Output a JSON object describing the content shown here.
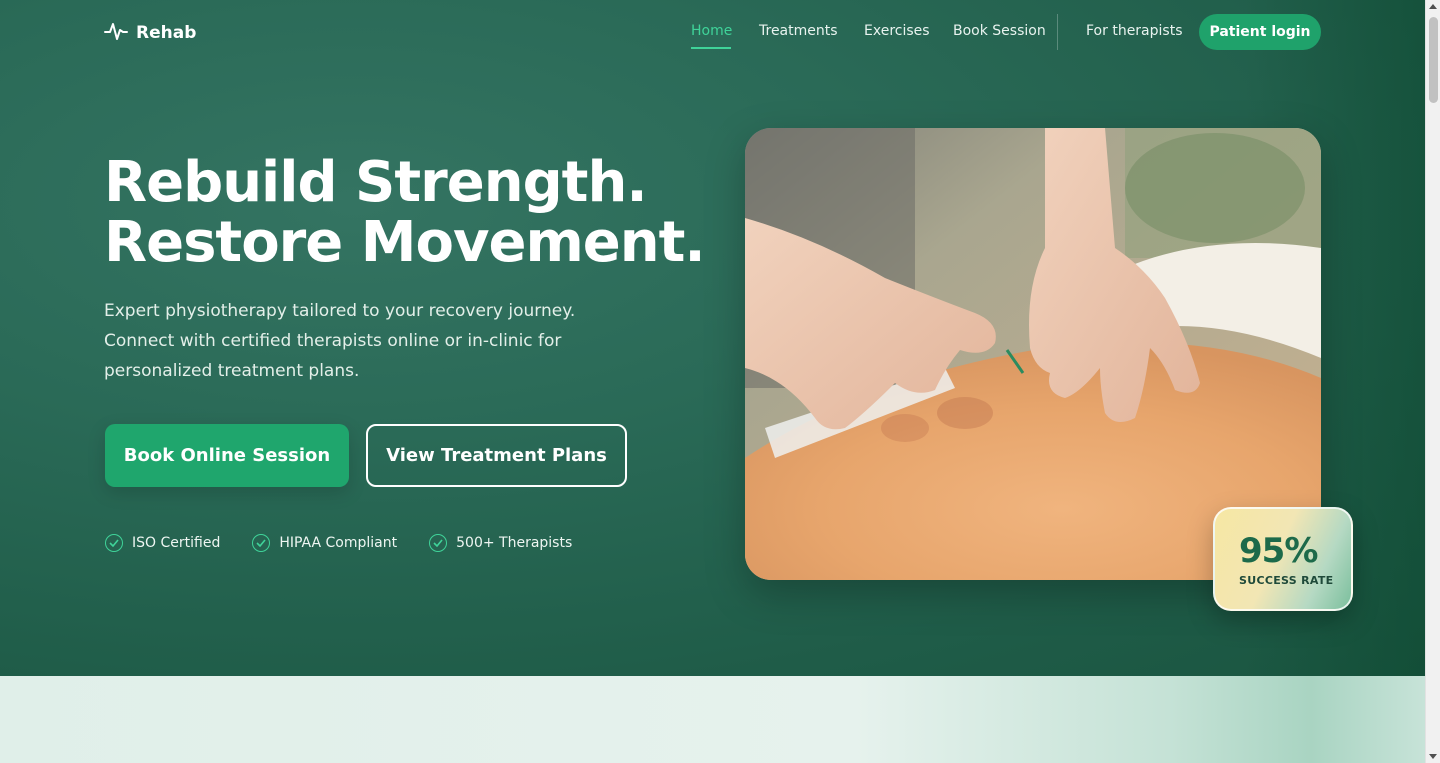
{
  "brand": {
    "name": "Rehab",
    "icon": "pulse-icon"
  },
  "nav": {
    "items": [
      {
        "label": "Home",
        "active": true
      },
      {
        "label": "Treatments",
        "active": false
      },
      {
        "label": "Exercises",
        "active": false
      },
      {
        "label": "Book Session",
        "active": false
      }
    ],
    "therapists_link": "For therapists",
    "login_button": "Patient login"
  },
  "hero": {
    "title_line1": "Rebuild Strength.",
    "title_line2": "Restore Movement.",
    "subtitle": "Expert physiotherapy tailored to your recovery journey. Connect with certified therapists online or in-clinic for personalized treatment plans.",
    "primary_button": "Book Online Session",
    "secondary_button": "View Treatment Plans",
    "badges": [
      "ISO Certified",
      "HIPAA Compliant",
      "500+ Therapists"
    ],
    "stat": {
      "value": "95%",
      "label": "SUCCESS RATE"
    }
  },
  "colors": {
    "hero_bg": "#2a6a57",
    "accent": "#1fa66d",
    "active_nav": "#3fd399"
  }
}
